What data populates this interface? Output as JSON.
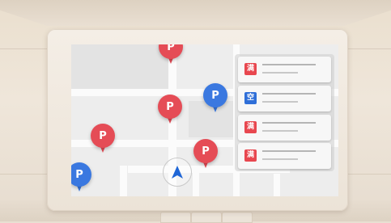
{
  "colors": {
    "pin_red": "#e54c56",
    "pin_blue": "#3a78e0",
    "badge_full": "#e8474f",
    "badge_empty": "#2f6fd8",
    "nav_arrow": "#1f66d6"
  },
  "map": {
    "pins": [
      {
        "label": "P",
        "type": "full"
      },
      {
        "label": "P",
        "type": "full"
      },
      {
        "label": "P",
        "type": "empty"
      },
      {
        "label": "P",
        "type": "full"
      },
      {
        "label": "P",
        "type": "full"
      },
      {
        "label": "P",
        "type": "empty"
      }
    ],
    "location_icon": "navigation-arrow-icon"
  },
  "parking_list": {
    "items": [
      {
        "badge": "满",
        "status": "full"
      },
      {
        "badge": "空",
        "status": "empty"
      },
      {
        "badge": "满",
        "status": "full"
      },
      {
        "badge": "满",
        "status": "full"
      }
    ]
  }
}
